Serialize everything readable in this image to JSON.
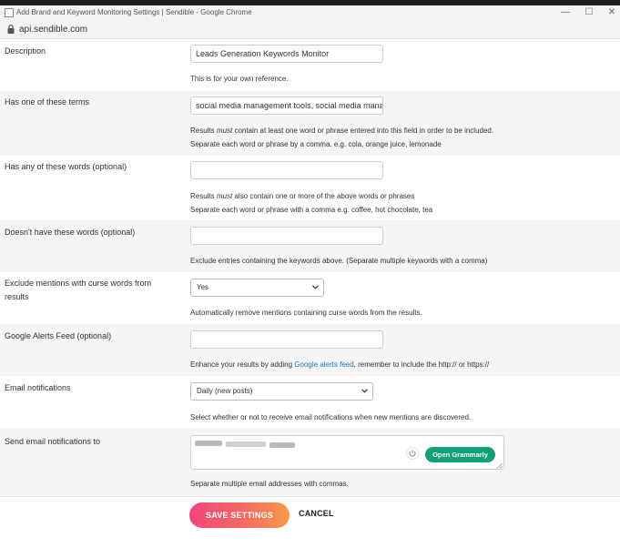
{
  "window": {
    "title": "Add Brand and Keyword Monitoring Settings | Sendible - Google Chrome",
    "minimize_glyph": "—",
    "maximize_glyph": "☐",
    "close_glyph": "✕"
  },
  "address_bar": {
    "url": "api.sendible.com"
  },
  "form": {
    "description": {
      "label": "Description",
      "value": "Leads Generation Keywords Monitor",
      "help": "This is for your own reference."
    },
    "has_one_of": {
      "label": "Has one of these terms",
      "value": "social media management tools, social media management platform",
      "help_prefix": "Results ",
      "help_em": "must",
      "help_suffix": " contain at least one word or phrase entered into this field in order to be included.",
      "help2": "Separate each word or phrase by a comma. e.g. cola, orange juice, lemonade"
    },
    "has_any_of": {
      "label": "Has any of these words (optional)",
      "value": "",
      "help_prefix": "Results ",
      "help_em": "must",
      "help_suffix": " also contain one or more of the above words or phrases",
      "help2": "Separate each word or phrase with a comma e.g. coffee, hot chocolate, tea"
    },
    "doesnt_have": {
      "label": "Doesn't have these words (optional)",
      "value": "",
      "help": "Exclude entries containing the keywords above. (Separate multiple keywords with a comma)"
    },
    "curse_words": {
      "label_line1": "Exclude mentions with curse words from",
      "label_line2": "results",
      "selected": "Yes",
      "help": "Automatically remove mentions containing curse words from the results."
    },
    "google_alerts": {
      "label": "Google Alerts Feed (optional)",
      "value": "",
      "help_prefix": "Enhance your results by adding ",
      "help_link": "Google alerts feed",
      "help_suffix": ", remember to include the http:// or https://"
    },
    "email_notifications": {
      "label": "Email notifications",
      "selected": "Daily (new posts)",
      "help": "Select whether or not to receive email notifications when new mentions are discovered."
    },
    "send_to": {
      "label": "Send email notifications to",
      "grammarly_label": "Open Grammarly",
      "help": "Separate multiple email addresses with commas."
    }
  },
  "actions": {
    "save_label": "SAVE SETTINGS",
    "cancel_label": "CANCEL"
  },
  "colors": {
    "grammarly_green": "#14a076",
    "save_gradient_start": "#f0457e",
    "save_gradient_end": "#f79a4a",
    "link_blue": "#1a78c2"
  },
  "icons": [
    "lock-icon",
    "chevron-down-icon",
    "power-icon",
    "resize-grip-icon"
  ]
}
